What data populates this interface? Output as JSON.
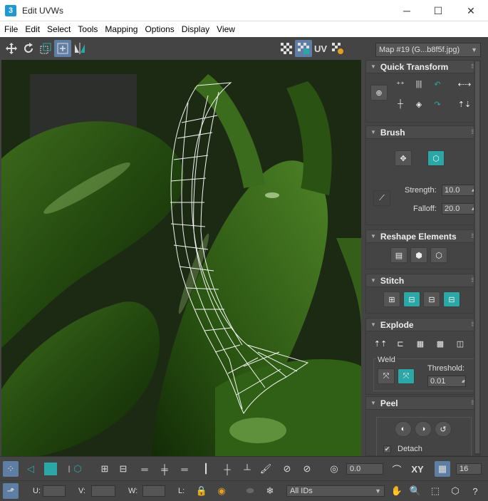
{
  "window": {
    "title": "Edit UVWs",
    "app_icon": "3",
    "minimize": "─",
    "maximize": "☐",
    "close": "✕"
  },
  "menu": [
    "File",
    "Edit",
    "Select",
    "Tools",
    "Mapping",
    "Options",
    "Display",
    "View"
  ],
  "top_toolbar": {
    "uv_label": "UV",
    "map_select": "Map #19 (G...b8f5f.jpg)"
  },
  "rollouts": {
    "quick_transform": {
      "title": "Quick Transform"
    },
    "brush": {
      "title": "Brush",
      "strength_label": "Strength:",
      "strength_value": "10.0",
      "falloff_label": "Falloff:",
      "falloff_value": "20.0"
    },
    "reshape": {
      "title": "Reshape Elements"
    },
    "stitch": {
      "title": "Stitch"
    },
    "explode": {
      "title": "Explode",
      "weld_label": "Weld",
      "threshold_label": "Threshold:",
      "threshold_value": "0.01"
    },
    "peel": {
      "title": "Peel",
      "detach_label": "Detach",
      "detach_checked": true
    }
  },
  "bottom_toolbar": {
    "angle_value": "0.0",
    "xy_label": "XY",
    "spin_value": "16",
    "u_label": "U:",
    "v_label": "V:",
    "w_label": "W:",
    "l_label": "L:",
    "ids_select": "All IDs"
  },
  "colors": {
    "panel": "#444444",
    "accent": "#2aa7a7",
    "active": "#5e7ea3"
  }
}
